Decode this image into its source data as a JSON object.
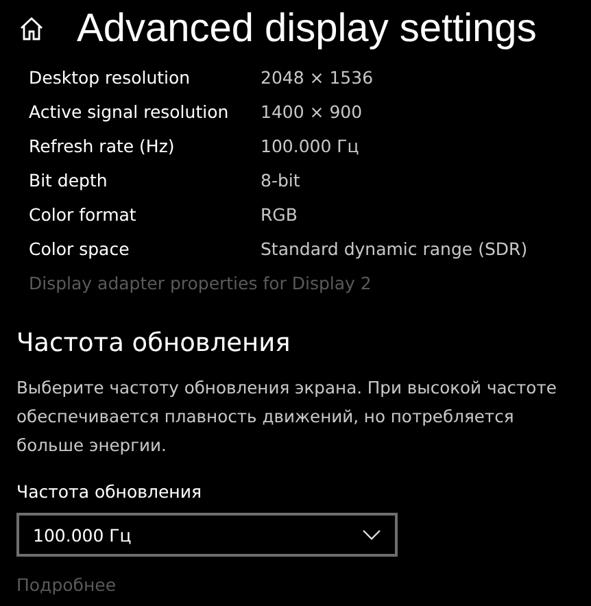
{
  "header": {
    "title": "Advanced display settings"
  },
  "info_rows": [
    {
      "label": "Desktop resolution",
      "value": "2048 × 1536"
    },
    {
      "label": "Active signal resolution",
      "value": "1400 × 900"
    },
    {
      "label": "Refresh rate (Hz)",
      "value": "100.000 Гц"
    },
    {
      "label": "Bit depth",
      "value": "8-bit"
    },
    {
      "label": "Color format",
      "value": "RGB"
    },
    {
      "label": "Color space",
      "value": "Standard dynamic range (SDR)"
    }
  ],
  "adapter_link": {
    "text": "Display adapter properties for Display 2",
    "disabled": true
  },
  "refresh_section": {
    "heading": "Частота обновления",
    "description": "Выберите частоту обновления экрана. При высокой частоте обеспечивается плавность движений, но потребляется больше энергии.",
    "dropdown_label": "Частота обновления",
    "dropdown_value": "100.000 Гц",
    "more_link": {
      "text": "Подробнее",
      "disabled": true
    }
  }
}
